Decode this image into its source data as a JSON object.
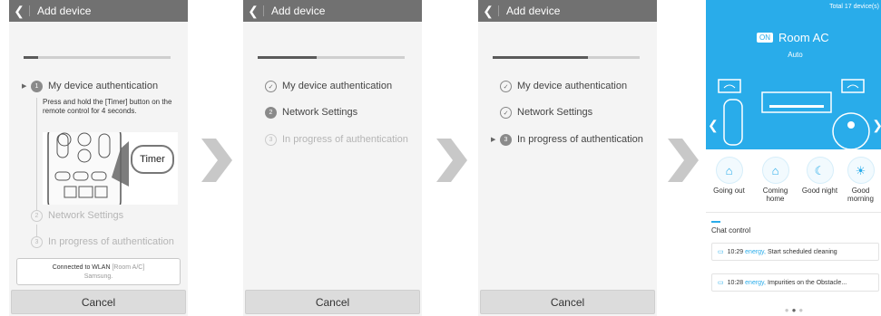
{
  "screens": [
    {
      "title": "Add device",
      "progress": 0.1,
      "steps": [
        {
          "number": "1",
          "label": "My device authentication",
          "state": "active"
        },
        {
          "number": "2",
          "label": "Network Settings",
          "state": "pending"
        },
        {
          "number": "3",
          "label": "In progress of authentication",
          "state": "pending"
        }
      ],
      "instruction": "Press and hold the [Timer] button on the remote control for 4 seconds.",
      "timer_label": "Timer",
      "wlan_line1_prefix": "Connected to WLAN",
      "wlan_line1_value": "[Room A/C]",
      "wlan_line2": "Samsung.",
      "cancel": "Cancel"
    },
    {
      "title": "Add device",
      "progress": 0.4,
      "steps": [
        {
          "number": "✓",
          "label": "My device authentication",
          "state": "done"
        },
        {
          "number": "2",
          "label": "Network Settings",
          "state": "active"
        },
        {
          "number": "3",
          "label": "In progress of authentication",
          "state": "pending"
        }
      ],
      "cancel": "Cancel"
    },
    {
      "title": "Add device",
      "progress": 0.65,
      "steps": [
        {
          "number": "✓",
          "label": "My device authentication",
          "state": "done"
        },
        {
          "number": "✓",
          "label": "Network Settings",
          "state": "done"
        },
        {
          "number": "3",
          "label": "In progress of authentication",
          "state": "active"
        }
      ],
      "cancel": "Cancel"
    }
  ],
  "app": {
    "total": "Total 17 device(s)",
    "on_badge": "ON",
    "device_name": "Room AC",
    "mode": "Auto",
    "quick_actions": [
      {
        "label": "Going out",
        "icon": "going-out-icon"
      },
      {
        "label": "Coming home",
        "icon": "coming-home-icon"
      },
      {
        "label": "Good night",
        "icon": "good-night-icon"
      },
      {
        "label": "Good morning",
        "icon": "good-morning-icon"
      }
    ],
    "chat_title": "Chat control",
    "chat_items": [
      {
        "time": "10:29",
        "sender": "energy,",
        "text": "Start scheduled cleaning"
      },
      {
        "time": "10:28",
        "sender": "energy,",
        "text": "Impurities on the Obstacle..."
      }
    ]
  },
  "colors": {
    "accent": "#29acea",
    "appbar": "#717171",
    "chevron": "#c8c8c8"
  }
}
